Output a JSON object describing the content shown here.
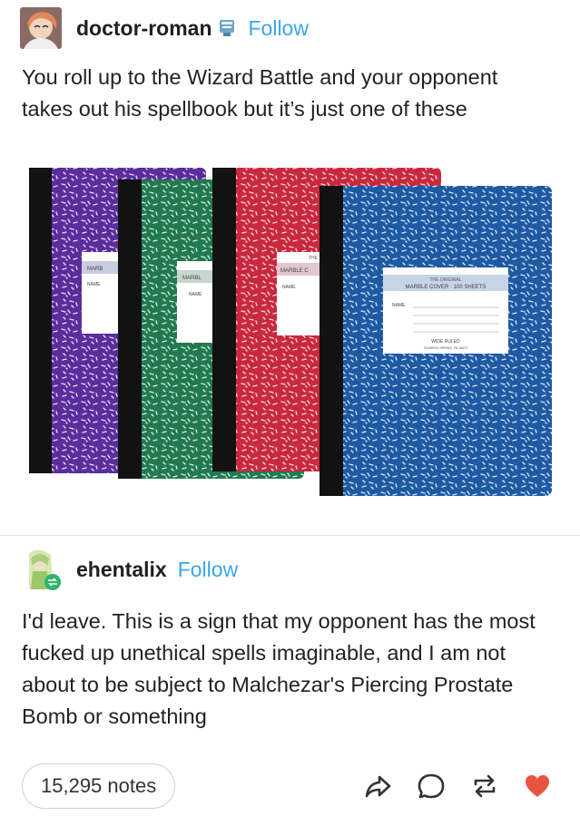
{
  "post": {
    "username": "doctor-roman",
    "follow_label": "Follow",
    "text": "You roll up to the Wizard Battle and your opponent takes out his spellbook but it’s just one of these"
  },
  "image": {
    "notebooks": [
      {
        "color": "#5a2c9c",
        "label_lines": [
          "MARB",
          "NAME"
        ]
      },
      {
        "color": "#217a4f",
        "label_lines": [
          "MARBL",
          "NAME"
        ]
      },
      {
        "color": "#c9283e",
        "label_lines": [
          "THE",
          "MARBLE C",
          "NAME"
        ]
      },
      {
        "color": "#1e5aa3",
        "label_lines": [
          "THE ORIGINAL",
          "MARBLE COVER · 100 SHEETS",
          "NAME",
          "WIDE RULED",
          "ROARING SPRING, PA 16673"
        ]
      }
    ]
  },
  "reblog": {
    "username": "ehentalix",
    "follow_label": "Follow",
    "text": "I'd leave. This is a sign that my opponent has the most fucked up unethical spells imaginable, and I am not about to be subject to Malchezar's Piercing Prostate Bomb or something"
  },
  "footer": {
    "notes": "15,295 notes",
    "actions": [
      "share-icon",
      "reply-icon",
      "reblog-icon",
      "like-icon"
    ],
    "like_color": "#e8543e"
  }
}
